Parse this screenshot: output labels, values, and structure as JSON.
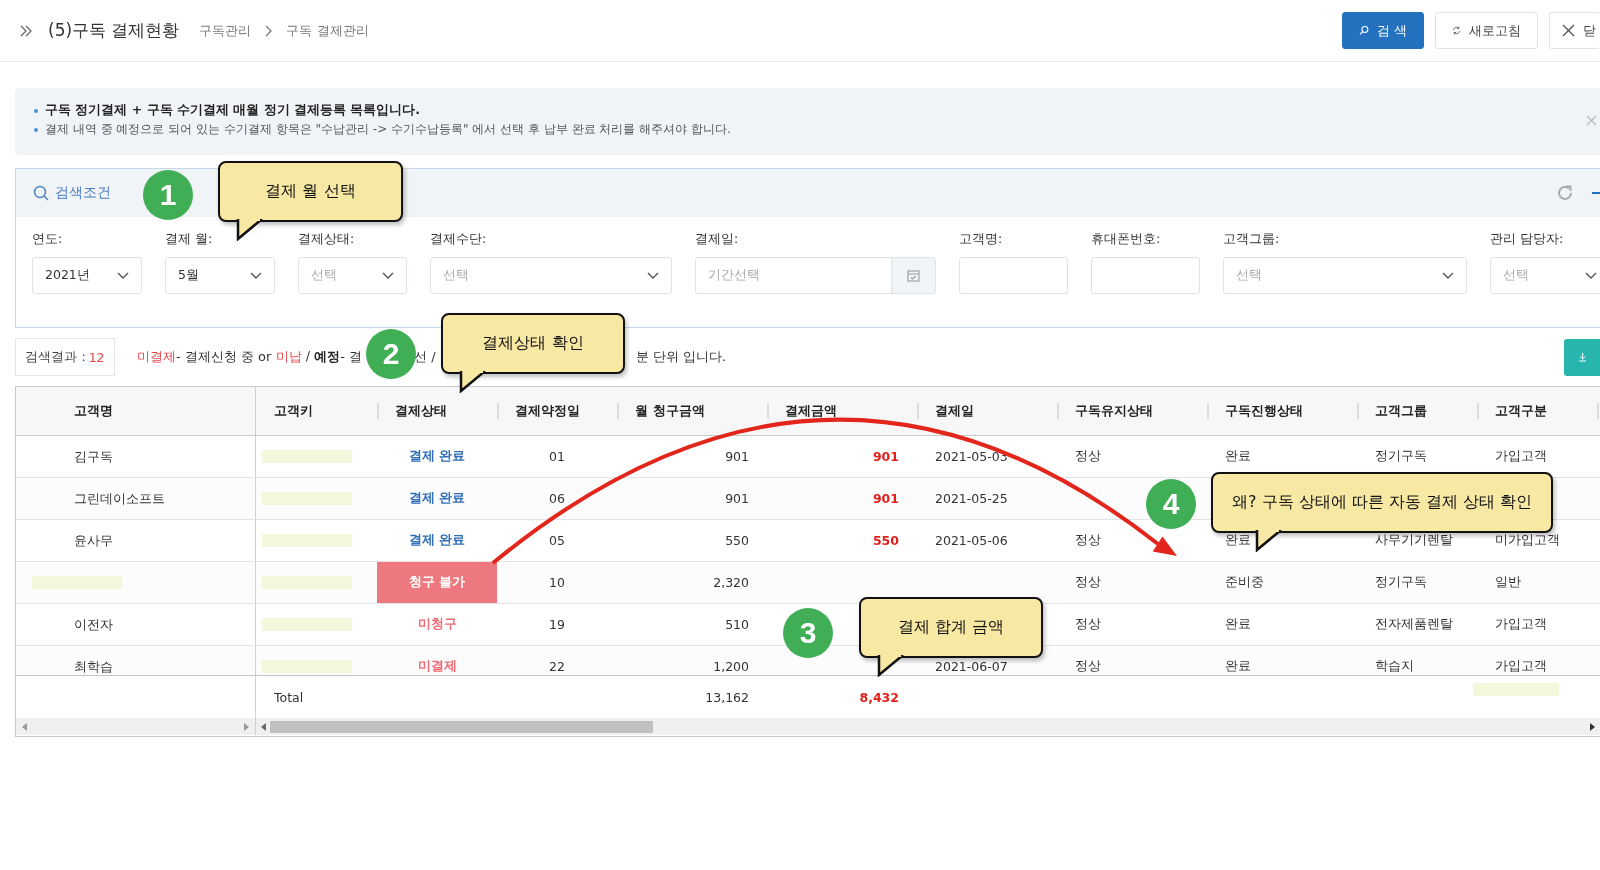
{
  "header": {
    "title": "(5)구독 결제현황",
    "breadcrumb": [
      "구독관리",
      "구독 결제관리"
    ],
    "buttons": [
      {
        "label": "검 색",
        "kind": "primary"
      },
      {
        "label": "새로고침",
        "kind": "refresh"
      },
      {
        "label": "닫",
        "kind": "close"
      }
    ]
  },
  "notice": {
    "lines": [
      {
        "text": "구독 정기결제 + 구독 수기결제 매월 정기 결제등록 목록입니다.",
        "bold": true
      },
      {
        "text": "결제 내역 중 예정으로 되어 있는 수기결제 항목은 \"수납관리 -> 수기수납등록\" 에서 선택 후 납부 완료 처리를 해주셔야 합니다.",
        "bold": false
      }
    ]
  },
  "search": {
    "title": "검색조건",
    "filters": [
      {
        "label": "연도:",
        "kind": "select",
        "value": "2021년"
      },
      {
        "label": "결제 월:",
        "kind": "select",
        "value": "5월"
      },
      {
        "label": "결제상태:",
        "kind": "select",
        "placeholder": "선택"
      },
      {
        "label": "결제수단:",
        "kind": "select",
        "placeholder": "선택"
      },
      {
        "label": "결제일:",
        "kind": "date",
        "placeholder": "기간선택"
      },
      {
        "label": "고객명:",
        "kind": "text"
      },
      {
        "label": "휴대폰번호:",
        "kind": "text"
      },
      {
        "label": "고객그룹:",
        "kind": "select",
        "placeholder": "선택"
      },
      {
        "label": "관리 담당자:",
        "kind": "select",
        "placeholder": "선택"
      }
    ]
  },
  "results": {
    "label": "검색결과 :",
    "count": "12",
    "legend": [
      {
        "text": "미결제",
        "kind": "alert"
      },
      {
        "text": "- 결제신청 중 or ",
        "kind": "plain"
      },
      {
        "text": "미납",
        "kind": "alert"
      },
      {
        "text": " / ",
        "kind": "plain"
      },
      {
        "text": "예정",
        "kind": "strong"
      },
      {
        "text": "- 결",
        "kind": "plain"
      },
      {
        "text": "선 /",
        "kind": "plain"
      },
      {
        "text": "분 단위 입니다.",
        "kind": "plain"
      }
    ]
  },
  "table": {
    "columns": [
      "고객명",
      "고객키",
      "결제상태",
      "결제약정일",
      "월 청구금액",
      "결제금액",
      "결제일",
      "구독유지상태",
      "구독진행상태",
      "고객그룹",
      "고객구분"
    ],
    "rows": [
      {
        "name": "김구독",
        "key_redacted": true,
        "status": {
          "text": "결제 완료",
          "kind": "done"
        },
        "due_day": "01",
        "billed": "901",
        "paid": "901",
        "paid_date": "2021-05-03",
        "keep_state": "정상",
        "progress": "완료",
        "group": "정기구독",
        "customer_type": "가입고객"
      },
      {
        "name": "그린데이소프트",
        "key_redacted": true,
        "status": {
          "text": "결제 완료",
          "kind": "done"
        },
        "due_day": "06",
        "billed": "901",
        "paid": "901",
        "paid_date": "2021-05-25"
      },
      {
        "name": "윤사무",
        "key_redacted": true,
        "status": {
          "text": "결제 완료",
          "kind": "done"
        },
        "due_day": "05",
        "billed": "550",
        "paid": "550",
        "paid_date": "2021-05-06",
        "keep_state": "정상",
        "progress": "완료",
        "group": "사무기기렌탈",
        "customer_type": "미가입고객"
      },
      {
        "name_redacted": true,
        "key_redacted": true,
        "status": {
          "text": "청구 불가",
          "kind": "blocked"
        },
        "due_day": "10",
        "billed": "2,320",
        "keep_state": "정상",
        "progress": "준비중",
        "group": "정기구독",
        "customer_type": "일반"
      },
      {
        "name": "이전자",
        "key_redacted": true,
        "status": {
          "text": "미청구",
          "kind": "pending"
        },
        "due_day": "19",
        "billed": "510",
        "keep_state": "정상",
        "progress": "완료",
        "group": "전자제품렌탈",
        "customer_type": "가입고객"
      },
      {
        "name": "최학습",
        "key_redacted": true,
        "status": {
          "text": "미결제",
          "kind": "pending"
        },
        "due_day": "22",
        "billed": "1,200",
        "paid_date": "2021-06-07",
        "keep_state": "정상",
        "progress": "완료",
        "group": "학습지",
        "customer_type": "가입고객"
      }
    ],
    "footer": {
      "label": "Total",
      "billed": "13,162",
      "paid": "8,432",
      "customer_type_redacted": true
    }
  },
  "annotations": [
    {
      "number": "1",
      "text": "결제 월 선택"
    },
    {
      "number": "2",
      "text": "결제상태 확인"
    },
    {
      "number": "3",
      "text": "결제 합계 금액"
    },
    {
      "number": "4",
      "text": "왜? 구독 상태에 따른 자동 결제 상태 확인"
    }
  ]
}
